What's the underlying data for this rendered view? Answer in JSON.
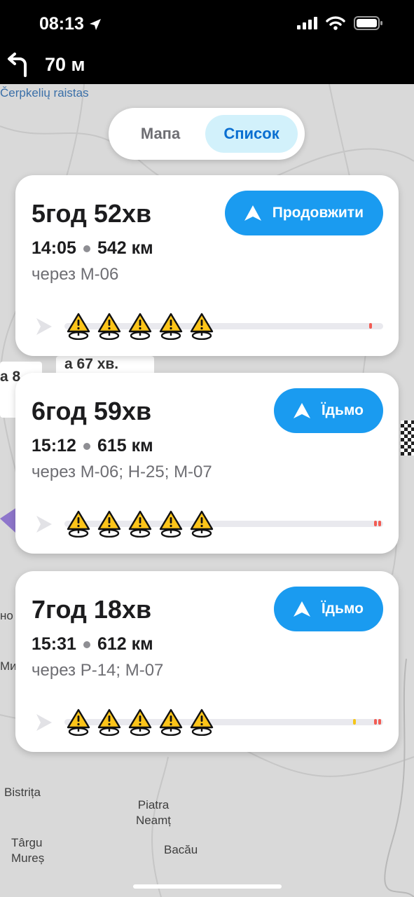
{
  "status_bar": {
    "time": "08:13"
  },
  "navigation": {
    "distance": "70 м"
  },
  "view_toggle": {
    "map_label": "Мапа",
    "list_label": "Список",
    "selected": "Список"
  },
  "map_labels": {
    "top_left": "Čerpkelių raistas",
    "peek_top": "а 67 хв.",
    "peek_left": "а 8",
    "bistrita": "Bistrița",
    "piatra": "Piatra Neamț",
    "targu": "Târgu Mureș",
    "bacau": "Bacău",
    "side_no": "но",
    "side_mi": "Ми"
  },
  "routes": [
    {
      "duration": "5год 52хв",
      "arrival": "14:05",
      "distance": "542 км",
      "via": "через М-06",
      "button": "Продовжити",
      "hazard_count": 5,
      "traffic_marks": [
        {
          "pos": 0.96,
          "color": "#f25c54"
        }
      ]
    },
    {
      "duration": "6год 59хв",
      "arrival": "15:12",
      "distance": "615 км",
      "via": "через М-06; Н-25; М-07",
      "button": "Їдьмо",
      "hazard_count": 5,
      "traffic_marks": [
        {
          "pos": 0.975,
          "color": "#f25c54"
        },
        {
          "pos": 0.99,
          "color": "#f25c54"
        }
      ]
    },
    {
      "duration": "7год 18хв",
      "arrival": "15:31",
      "distance": "612 км",
      "via": "через Р-14; М-07",
      "button": "Їдьмо",
      "hazard_count": 5,
      "traffic_marks": [
        {
          "pos": 0.91,
          "color": "#f5c518"
        },
        {
          "pos": 0.975,
          "color": "#f25c54"
        },
        {
          "pos": 0.99,
          "color": "#f25c54"
        }
      ]
    }
  ],
  "colors": {
    "accent": "#1a9bf0",
    "toggle_selected_bg": "#d2f1fb",
    "toggle_selected_text": "#0a6fd1"
  }
}
